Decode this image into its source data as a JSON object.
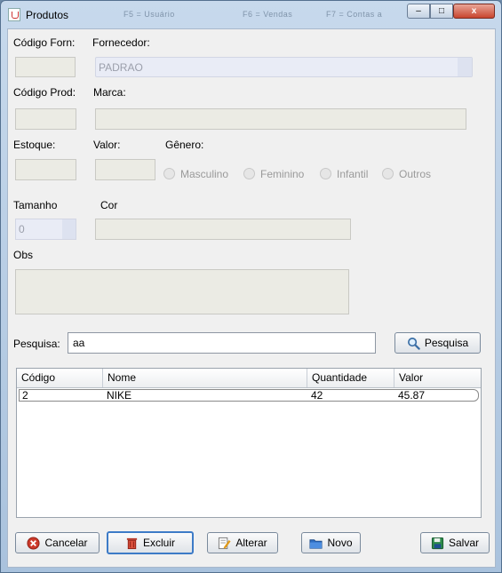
{
  "window": {
    "title": "Produtos",
    "background_titles": [
      "F5 = Usuário",
      "F6 = Vendas",
      "F7 = Contas a"
    ],
    "minimize_glyph": "–",
    "maximize_glyph": "□",
    "close_glyph": "x"
  },
  "form": {
    "codigo_forn_label": "Código Forn:",
    "fornecedor_label": "Fornecedor:",
    "fornecedor_value": "PADRAO",
    "codigo_prod_label": "Código Prod:",
    "marca_label": "Marca:",
    "estoque_label": "Estoque:",
    "valor_label": "Valor:",
    "genero_label": "Gênero:",
    "genero_options": [
      "Masculino",
      "Feminino",
      "Infantil",
      "Outros"
    ],
    "tamanho_label": "Tamanho",
    "tamanho_value": "0",
    "cor_label": "Cor",
    "obs_label": "Obs"
  },
  "search": {
    "label": "Pesquisa:",
    "value": "aa",
    "button_label": "Pesquisa"
  },
  "table": {
    "columns": [
      "Código",
      "Nome",
      "Quantidade",
      "Valor"
    ],
    "rows": [
      [
        "2",
        "NIKE",
        "42",
        "45.87"
      ]
    ]
  },
  "actions": {
    "cancel_label": "Cancelar",
    "delete_label": "Excluir",
    "edit_label": "Alterar",
    "new_label": "Novo",
    "save_label": "Salvar"
  },
  "icons": [
    "java-app-icon",
    "magnifier-icon",
    "cancel-icon",
    "trash-icon",
    "edit-icon",
    "folder-icon",
    "floppy-disk-icon"
  ],
  "colors": {
    "accent": "#1e5aa0",
    "cancel": "#cc3a2b",
    "window_frame": "#a9c2dd"
  }
}
